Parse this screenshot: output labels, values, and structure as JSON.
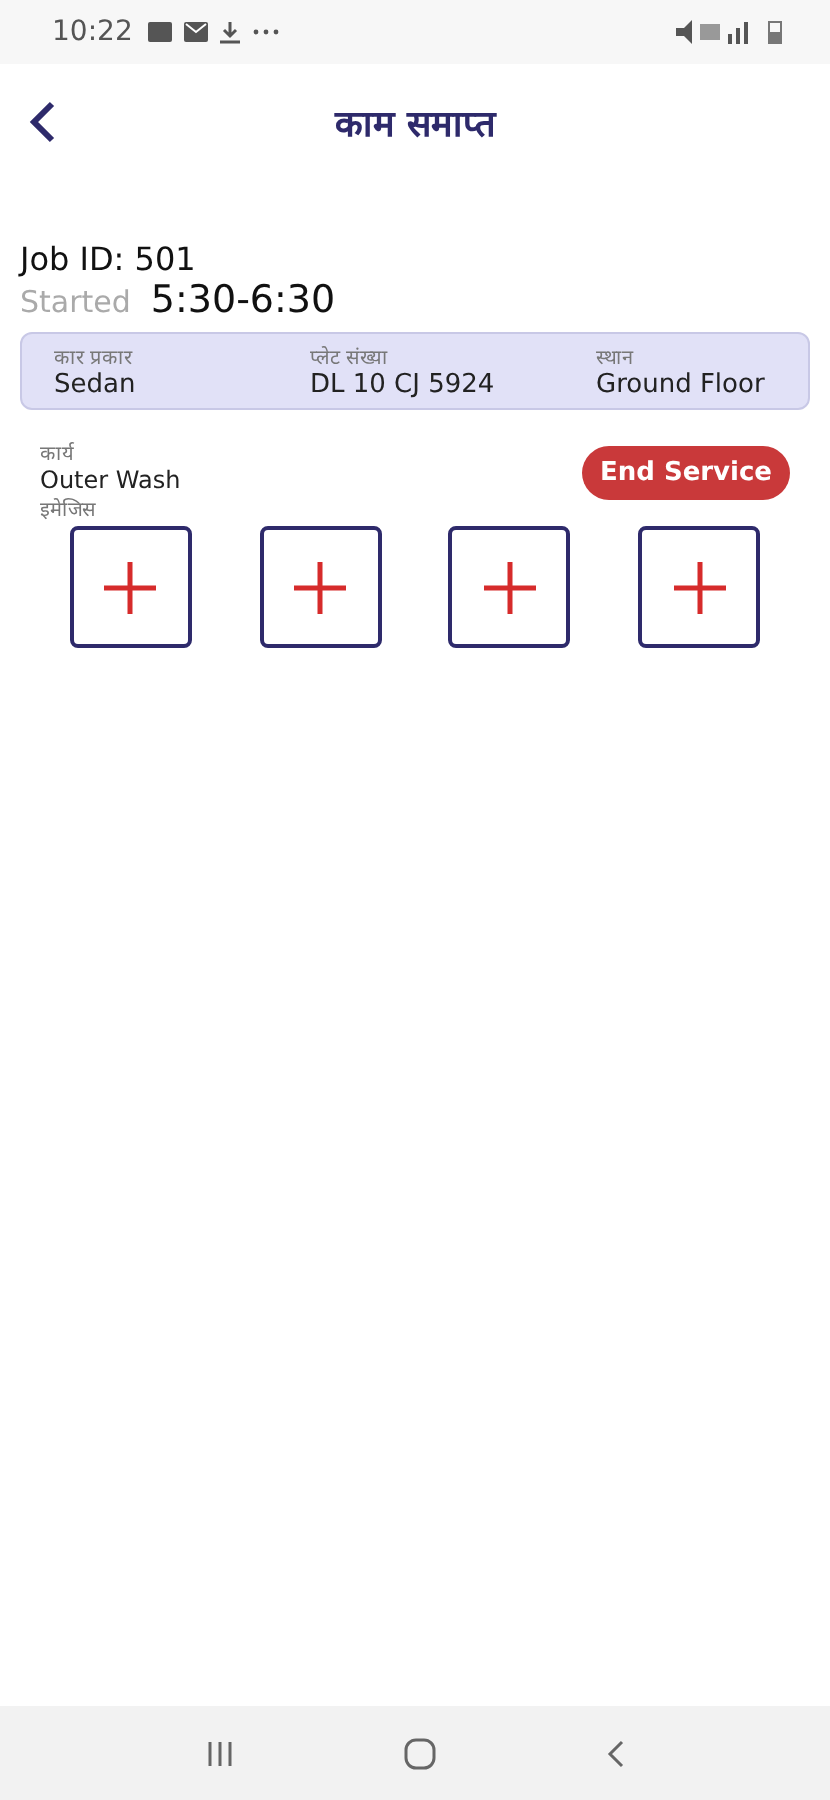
{
  "status_bar": {
    "time": "10:22"
  },
  "header": {
    "title": "काम समाप्त"
  },
  "job": {
    "id_label": "Job ID: 501",
    "started_label": "Started",
    "time_range": "5:30-6:30"
  },
  "details": [
    {
      "label": "कार प्रकार",
      "value": "Sedan"
    },
    {
      "label": "प्लेट संख्या",
      "value": "DL 10 CJ 5924"
    },
    {
      "label": "स्थान",
      "value": "Ground Floor"
    }
  ],
  "task": {
    "label": "कार्य",
    "value": "Outer Wash",
    "images_label": "इमेजिस"
  },
  "end_button": "End Service",
  "image_slots": [
    {
      "kind": "add"
    },
    {
      "kind": "add"
    },
    {
      "kind": "add"
    },
    {
      "kind": "add"
    }
  ]
}
